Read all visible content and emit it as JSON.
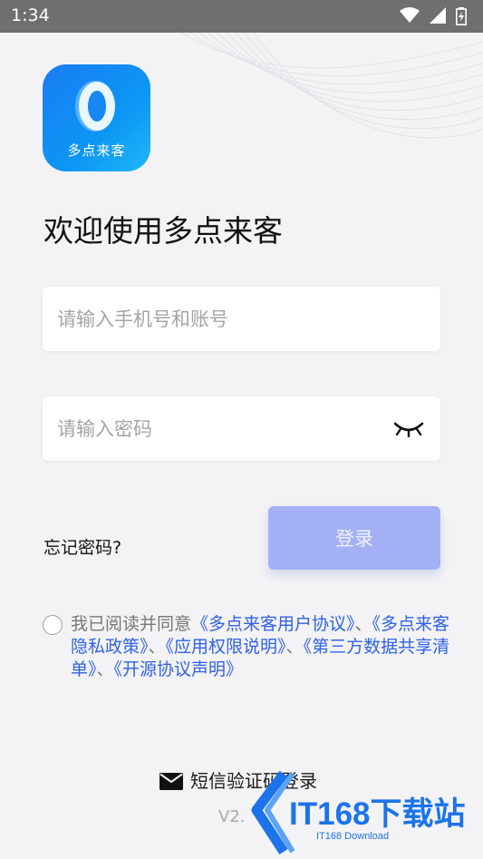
{
  "status_bar": {
    "time": "1:34",
    "icons": [
      "wifi-icon",
      "signal-icon",
      "battery-charging-icon"
    ]
  },
  "logo": {
    "app_name": "多点来客",
    "colors": {
      "start": "#1a7cf2",
      "end": "#1fb7f7"
    }
  },
  "welcome": {
    "title": "欢迎使用多点来客"
  },
  "form": {
    "account": {
      "placeholder": "请输入手机号和账号",
      "value": ""
    },
    "password": {
      "placeholder": "请输入密码",
      "value": "",
      "visibility_icon": "eye-closed-icon"
    },
    "forgot_label": "忘记密码?",
    "login_label": "登录"
  },
  "agreement": {
    "checked": false,
    "prefix": "我已阅读并同意",
    "links": [
      "《多点来客用户协议》",
      "《多点来客隐私政策》",
      "《应用权限说明》",
      "《第三方数据共享清单》",
      "《开源协议声明》"
    ],
    "separator": "、"
  },
  "alt_login": {
    "label": "短信验证码登录",
    "icon": "mail-icon"
  },
  "version": "V2.",
  "watermark": {
    "text": "IT168下载站",
    "subtext": "IT168 Download"
  },
  "colors": {
    "accent": "#2f62e6",
    "login_button": "#a3b0f5",
    "background": "#f3f3f5"
  }
}
